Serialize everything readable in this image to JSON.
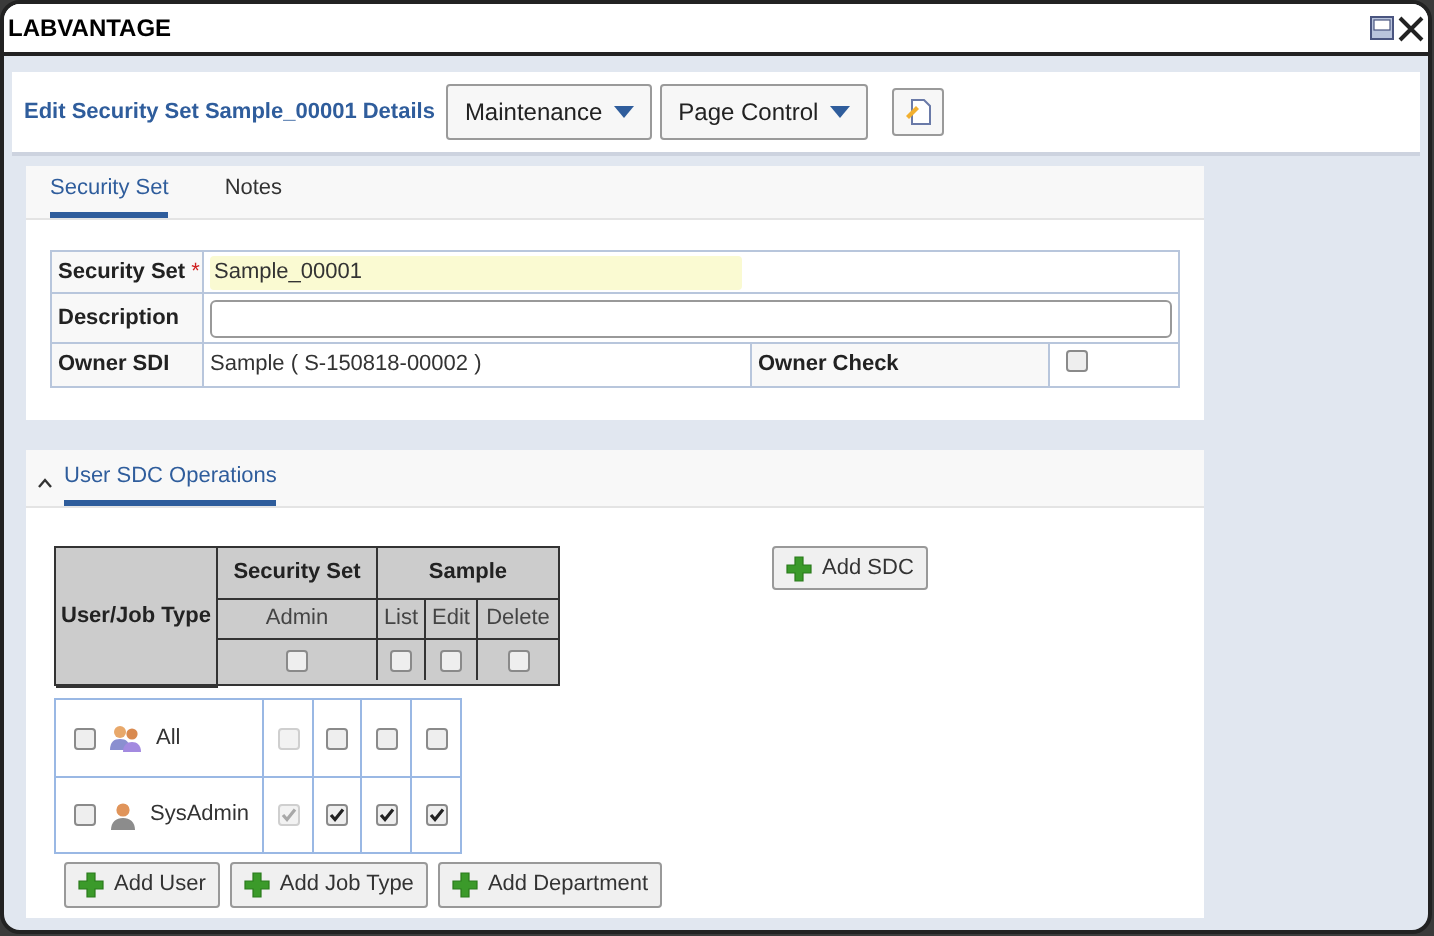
{
  "window": {
    "title": "LABVANTAGE"
  },
  "header": {
    "title": "Edit Security Set Sample_00001 Details",
    "menus": [
      "Maintenance",
      "Page Control"
    ]
  },
  "tabs": [
    {
      "label": "Security Set",
      "selected": true
    },
    {
      "label": "Notes",
      "selected": false
    }
  ],
  "form": {
    "security_set": {
      "label": "Security Set",
      "required_mark": "*",
      "value": "Sample_00001"
    },
    "description": {
      "label": "Description"
    },
    "owner_sdi": {
      "label": "Owner SDI",
      "value": "Sample ( S-150818-00002 )"
    },
    "owner_check": {
      "label": "Owner Check",
      "checked": false
    }
  },
  "section": {
    "title": "User SDC Operations",
    "expanded": true
  },
  "grid": {
    "corner": "User/Job Type",
    "groups": [
      {
        "label": "Security Set",
        "columns": [
          "Admin"
        ]
      },
      {
        "label": "Sample",
        "columns": [
          "List",
          "Edit",
          "Delete"
        ]
      }
    ],
    "header_checks": [
      false,
      false,
      false,
      false
    ],
    "rows": [
      {
        "name": "All",
        "kind": "group",
        "checked": false,
        "perms": [
          {
            "checked": false,
            "disabled": true
          },
          {
            "checked": false,
            "disabled": false
          },
          {
            "checked": false,
            "disabled": false
          },
          {
            "checked": false,
            "disabled": false
          }
        ]
      },
      {
        "name": "SysAdmin",
        "kind": "user",
        "checked": false,
        "perms": [
          {
            "checked": true,
            "disabled": true
          },
          {
            "checked": true,
            "disabled": false
          },
          {
            "checked": true,
            "disabled": false
          },
          {
            "checked": true,
            "disabled": false
          }
        ]
      }
    ]
  },
  "add_sdc": "Add SDC",
  "buttons": [
    "Add User",
    "Add Job Type",
    "Add Department"
  ]
}
